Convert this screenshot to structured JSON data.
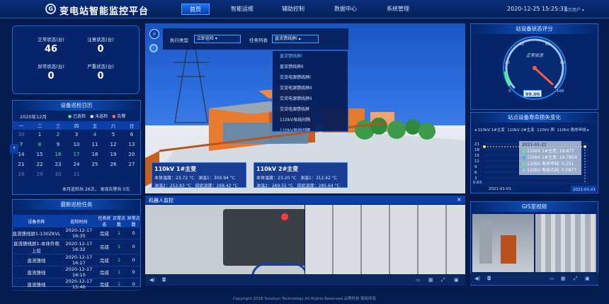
{
  "header": {
    "logo": "G",
    "title": "变电站智能监控平台",
    "nav": [
      "首页",
      "智能运维",
      "辅助控制",
      "数据中心",
      "系统管理"
    ],
    "datetime": "2020-12-25 15:25:37",
    "user": "演示用户 ▾"
  },
  "stats": {
    "normal_label": "正常状态(台)",
    "normal_value": "46",
    "attention_label": "注意状态(台)",
    "attention_value": "0",
    "abnormal_label": "异常状态(台)",
    "abnormal_value": "0",
    "severe_label": "严重状态(台)",
    "severe_value": "0"
  },
  "calendar": {
    "title": "设备巡检日历",
    "month": "2020年12月",
    "legend": [
      "已巡检",
      "未巡检",
      "告警"
    ],
    "weekdays": [
      "一",
      "二",
      "三",
      "四",
      "五",
      "六",
      "日"
    ],
    "rows": [
      [
        [
          "30",
          "o"
        ],
        [
          "1",
          ""
        ],
        [
          "2",
          "g"
        ],
        [
          "3",
          ""
        ],
        [
          "4",
          "g"
        ],
        [
          "5",
          ""
        ],
        [
          "6",
          ""
        ]
      ],
      [
        [
          "7",
          ""
        ],
        [
          "8",
          "g"
        ],
        [
          "9",
          ""
        ],
        [
          "10",
          ""
        ],
        [
          "11",
          ""
        ],
        [
          "12",
          ""
        ],
        [
          "13",
          ""
        ]
      ],
      [
        [
          "14",
          ""
        ],
        [
          "15",
          ""
        ],
        [
          "16",
          "g"
        ],
        [
          "17",
          "g"
        ],
        [
          "18",
          ""
        ],
        [
          "19",
          ""
        ],
        [
          "20",
          ""
        ]
      ],
      [
        [
          "21",
          ""
        ],
        [
          "22",
          ""
        ],
        [
          "23",
          ""
        ],
        [
          "24",
          ""
        ],
        [
          "25",
          ""
        ],
        [
          "26",
          ""
        ],
        [
          "27",
          ""
        ]
      ],
      [
        [
          "28",
          "o"
        ],
        [
          "29",
          "o"
        ],
        [
          "30",
          "o"
        ],
        [
          "31",
          "o"
        ],
        [
          "",
          ""
        ],
        [
          "",
          ""
        ],
        [
          "",
          ""
        ]
      ]
    ],
    "footer": "本月巡检共 26次， 发现告警共 0次"
  },
  "tasks": {
    "title": "最新巡检任务",
    "headers": [
      "设备名称",
      "巡检时间",
      "任务状态",
      "正常点数",
      "异常点数"
    ],
    "rows": [
      [
        "直流馈线屏1-130ZKVL",
        "2020-12-17 16:35",
        "完成",
        "1",
        "0"
      ],
      [
        "直流馈线屏1-本体外观上层",
        "2020-12-17 16:32",
        "完成",
        "1",
        "0"
      ],
      [
        "直流馈线",
        "2020-12-17 16:27",
        "完成",
        "1",
        "0"
      ],
      [
        "直流馈线",
        "2020-12-17 16:10",
        "完成",
        "1",
        "0"
      ],
      [
        "直流馈线",
        "2020-12-17 15:46",
        "完成",
        "1",
        "0"
      ]
    ]
  },
  "scene": {
    "exec_type_label": "执行类型",
    "exec_type_value": "立即巡检 ▾",
    "task_list_label": "任务列表",
    "task_list_value": "直流馈线屏I ▴",
    "dropdown": [
      "直流馈线屏I",
      "直流馈线屏II",
      "交流电源馈线屏I",
      "交流电源馈线屏II",
      "交流电源馈线屏II",
      "交流电源馈线屏",
      "110kV母线间隔",
      "110kV母线间隔"
    ],
    "t1": {
      "name": "110kV 1#主变",
      "a": "本体温度：23.72 °C",
      "b": "油温1：309.94 °C",
      "c": "油温2：252.83 °C",
      "d": "绕组温度：268.42 °C"
    },
    "t2": {
      "name": "110kV 2#主变",
      "a": "本体温度：23.20 °C",
      "b": "油温1：312.42 °C",
      "c": "油温2：269.55 °C",
      "d": "绕组温度：285.64 °C"
    }
  },
  "robot": {
    "title": "机器人监控",
    "close": "×"
  },
  "score": {
    "title": "站设备状态评分",
    "center": "正常状态",
    "value": "99.00",
    "ticks": [
      "0",
      "20",
      "40",
      "60",
      "80",
      "100"
    ],
    "fraction": 0.99
  },
  "trend": {
    "title": "站点设备寿命损失变化",
    "legend": [
      "110kV 1#主变",
      "110kV 2#主变",
      "110kV 两",
      "110kV 寿命甲线"
    ],
    "start": "0.63",
    "x_start": "2021-01-01",
    "x_end": "2021-01-21",
    "y_ticks": [
      "21",
      "18",
      "15",
      "12",
      "9",
      "6",
      "3",
      "0"
    ],
    "tooltip": {
      "date": "2021-01-21",
      "lines": [
        "110kV 1#主变: 19.877",
        "110kV 2#主变: 19.7854",
        "110kV 寿命甲线: 0.251",
        "110kV 寿命乙线: 0.0877"
      ]
    }
  },
  "gis": {
    "title": "GIS室视频"
  },
  "footer": "Copyright 2018 Yunshun Technology All Rights Reserved.云舜科技 版权所有",
  "colors": {
    "green": "#4cf08b",
    "accent": "#4aa3ff",
    "gauge": "#ff5b3c"
  }
}
